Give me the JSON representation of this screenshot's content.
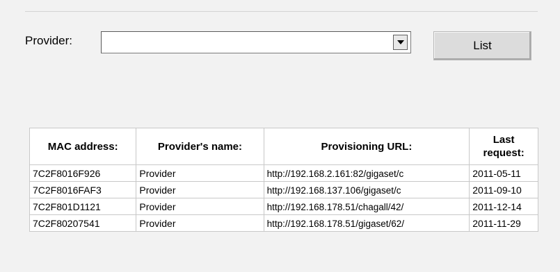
{
  "form": {
    "provider_label": "Provider:",
    "provider_value": "",
    "list_button_label": "List"
  },
  "icons": {
    "dropdown": "chevron-down-icon"
  },
  "table": {
    "headers": {
      "mac": "MAC address:",
      "name": "Provider's name:",
      "url": "Provisioning URL:",
      "last_request_line1": "Last",
      "last_request_line2": "request:"
    },
    "rows": [
      {
        "mac": "7C2F8016F926",
        "name": "Provider",
        "url": "http://192.168.2.161:82/gigaset/c",
        "date": "2011-05-11"
      },
      {
        "mac": "7C2F8016FAF3",
        "name": "Provider",
        "url": "http://192.168.137.106/gigaset/c",
        "date": "2011-09-10"
      },
      {
        "mac": "7C2F801D1121",
        "name": "Provider",
        "url": "http://192.168.178.51/chagall/42/",
        "date": "2011-12-14"
      },
      {
        "mac": "7C2F80207541",
        "name": "Provider",
        "url": "http://192.168.178.51/gigaset/62/",
        "date": "2011-11-29"
      }
    ]
  }
}
